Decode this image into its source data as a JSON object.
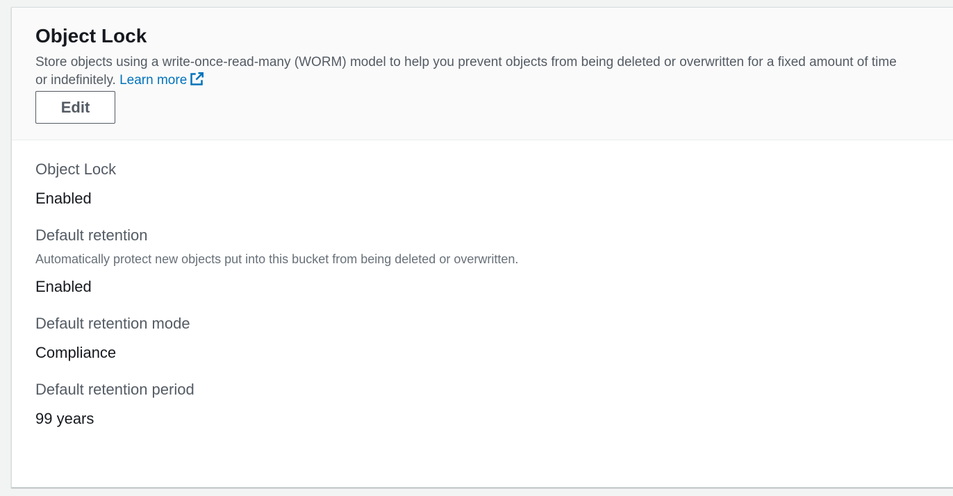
{
  "panel": {
    "title": "Object Lock",
    "description": "Store objects using a write-once-read-many (WORM) model to help you prevent objects from being deleted or overwritten for a fixed amount of time or indefinitely.",
    "learn_more": "Learn more",
    "learn_more_icon": "external-link-icon",
    "edit_label": "Edit",
    "link_color": "#0073bb"
  },
  "properties": {
    "object_lock": {
      "key": "Object Lock",
      "value": "Enabled"
    },
    "default_retention": {
      "key": "Default retention",
      "description": "Automatically protect new objects put into this bucket from being deleted or overwritten.",
      "value": "Enabled"
    },
    "retention_mode": {
      "key": "Default retention mode",
      "value": "Compliance"
    },
    "retention_period": {
      "key": "Default retention period",
      "value": "99 years"
    }
  }
}
